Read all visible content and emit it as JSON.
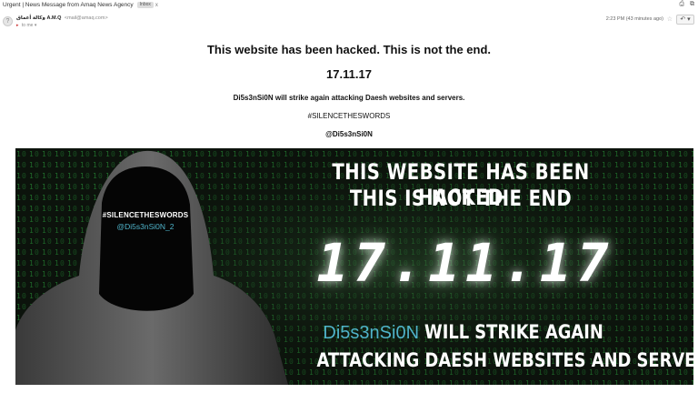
{
  "header": {
    "subject": "Urgent | News Message from Amaq News Agency",
    "inbox_tag": "Inbox",
    "tag_close": "x",
    "print_icon": "printer-icon",
    "newwindow_icon": "new-window-icon"
  },
  "sender": {
    "avatar_glyph": "?",
    "name": "وكالة أعماق A.M.Q",
    "email": "<mail@amaq.com>",
    "recipient": "to me",
    "recipient_flag": "▾",
    "timestamp": "2:23 PM (43 minutes ago)",
    "star_glyph": "☆",
    "reply_glyph": "↶ ▾"
  },
  "message": {
    "headline": "This website has been hacked. This is not the end.",
    "date": "17.11.17",
    "strike_line": "Di5s3nSi0N will strike again attacking Daesh websites and servers.",
    "hashtag": "#SILENCETHESWORDS",
    "handle": "@Di5s3nSi0N"
  },
  "banner": {
    "hashtag": "#SILENCETHESWORDS",
    "handle": "@Di5s3nSi0N_2",
    "title_line1": "THIS WEBSITE HAS BEEN HACKED",
    "title_line2": "THIS IS NOT THE END",
    "date": "17.11.17",
    "group_name": "Di5s3nSi0N",
    "strike_rest": "WILL STRIKE AGAIN",
    "attack_line": "ATTACKING DAESH WEBSITES AND SERVERS"
  },
  "colors": {
    "banner_bg": "#0c130c",
    "matrix_green": "#1f6b2a",
    "cyan_accent": "#4fb3c9"
  }
}
